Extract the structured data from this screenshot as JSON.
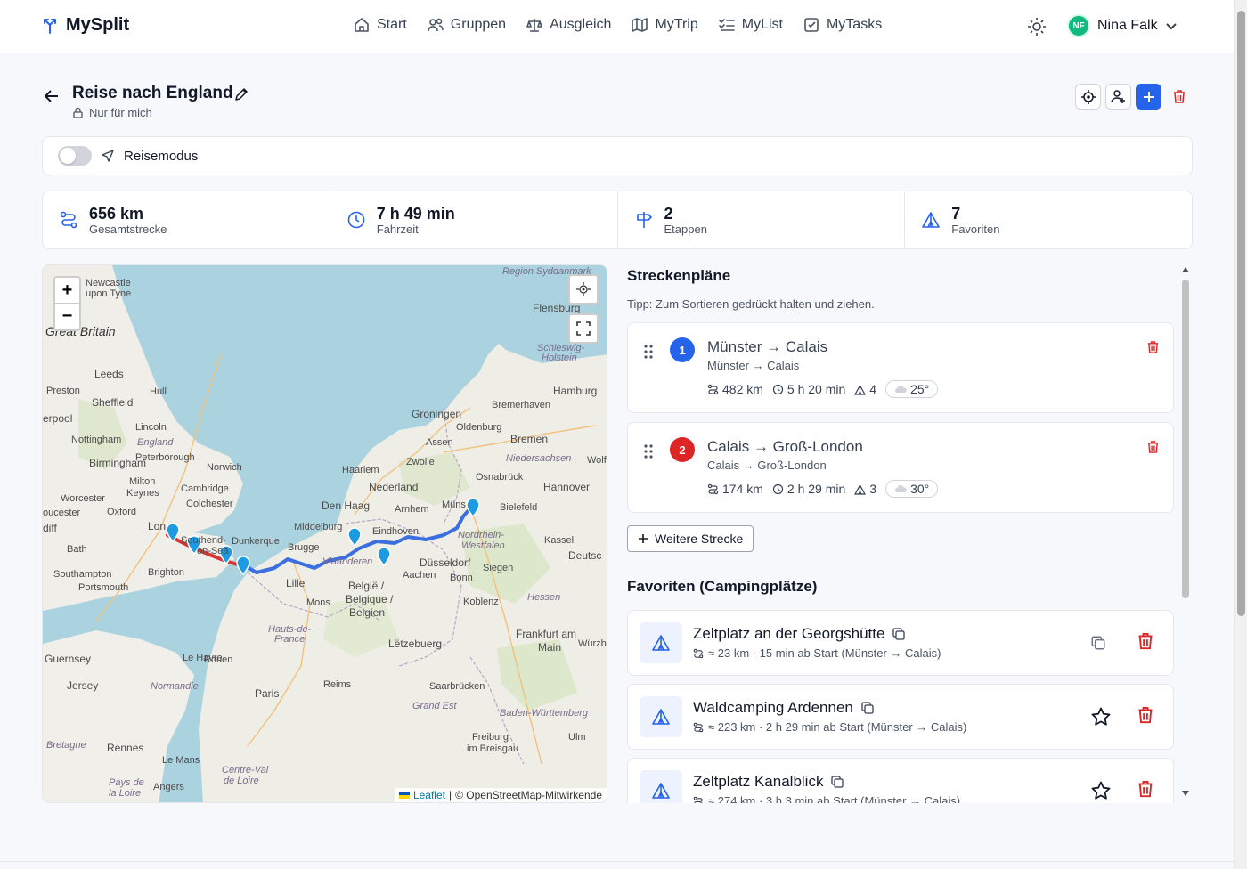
{
  "app": {
    "name": "MySplit"
  },
  "nav": [
    {
      "id": "start",
      "label": "Start",
      "icon": "home-icon"
    },
    {
      "id": "gruppen",
      "label": "Gruppen",
      "icon": "users-icon"
    },
    {
      "id": "ausgleich",
      "label": "Ausgleich",
      "icon": "scale-icon"
    },
    {
      "id": "mytrip",
      "label": "MyTrip",
      "icon": "map-icon"
    },
    {
      "id": "mylist",
      "label": "MyList",
      "icon": "list-check-icon"
    },
    {
      "id": "mytasks",
      "label": "MyTasks",
      "icon": "checkbox-icon"
    }
  ],
  "user": {
    "initials": "NF",
    "name": "Nina Falk"
  },
  "trip": {
    "title": "Reise nach England",
    "privacy": "Nur für mich",
    "travel_mode_label": "Reisemodus",
    "travel_mode_on": false
  },
  "stats": [
    {
      "value": "656 km",
      "label": "Gesamtstrecke",
      "icon": "route-icon"
    },
    {
      "value": "7 h 49 min",
      "label": "Fahrzeit",
      "icon": "clock-icon"
    },
    {
      "value": "2",
      "label": "Etappen",
      "icon": "signpost-icon"
    },
    {
      "value": "7",
      "label": "Favoriten",
      "icon": "tent-icon"
    }
  ],
  "map": {
    "zoom_in": "+",
    "zoom_out": "−",
    "attribution_link": "Leaflet",
    "attribution_sep": "|",
    "attribution_text": "© OpenStreetMap-Mitwirkende",
    "labels": {
      "region_syddanmark": "Region Syddanmark",
      "newcastle": "Newcastle",
      "upon_tyne": "upon Tyne",
      "flensburg": "Flensburg",
      "great_britain": "Great Britain",
      "schleswig": "Schleswig-",
      "holstein": "Holstein",
      "leeds": "Leeds",
      "preston": "Preston",
      "hull": "Hull",
      "hamburg": "Hamburg",
      "sheffield": "Sheffield",
      "groningen": "Groningen",
      "bremerhaven": "Bremerhaven",
      "liverpool": "erpool",
      "lincoln": "Lincoln",
      "oldenburg": "Oldenburg",
      "nottingham": "Nottingham",
      "england": "England",
      "assen": "Assen",
      "bremen": "Bremen",
      "birmingham": "Birmingham",
      "peterborough": "Peterborough",
      "norwich": "Norwich",
      "zwolle": "Zwolle",
      "niedersachsen": "Niedersachsen",
      "wolf": "Wolf",
      "haarlem": "Haarlem",
      "osnabrueck": "Osnabrück",
      "milton": "Milton",
      "keynes": "Keynes",
      "cambridge": "Cambridge",
      "nederland": "Nederland",
      "hannover": "Hannover",
      "worcester": "Worcester",
      "colchester": "Colchester",
      "den_haag": "Den Haag",
      "arnhem": "Arnhem",
      "muenster": "Müns",
      "bielefeld": "Bielefeld",
      "gloucester": "oucester",
      "oxford": "Oxford",
      "cardiff": "diff",
      "london": "Lon",
      "southend": "Southend-",
      "on_sea": "on-Sea",
      "middelburg": "Middelburg",
      "eindhoven": "Eindhoven",
      "nordrhein": "Nordrhein-",
      "westfalen": "Westfalen",
      "kassel": "Kassel",
      "bath": "Bath",
      "dunkerque": "Dunkerque",
      "brugge": "Brugge",
      "vlaanderen": "Vlaanderen",
      "duesseldorf": "Düsseldorf",
      "siegen": "Siegen",
      "deutschland": "Deutsc",
      "southampton": "Southampton",
      "brighton": "Brighton",
      "aachen": "Aachen",
      "bonn": "Bonn",
      "portsmouth": "Portsmouth",
      "lille": "Lille",
      "belgie": "België /",
      "belgique": "Belgique /",
      "belgien": "Belgien",
      "hessen": "Hessen",
      "mons": "Mons",
      "koblenz": "Koblenz",
      "hauts_de": "Hauts-de-",
      "france_region": "France",
      "letzebuerg": "Lëtzebuerg",
      "frankfurt": "Frankfurt am",
      "main": "Main",
      "guernsey": "Guernsey",
      "le_havre": "Le Havre",
      "rouen": "Rouen",
      "wuerzburg": "Würzbu",
      "jersey": "Jersey",
      "normandie": "Normandie",
      "paris": "Paris",
      "reims": "Reims",
      "saarbruecken": "Saarbrücken",
      "grand_est": "Grand Est",
      "bw_baden": "Baden-Württemberg",
      "bretagne": "Bretagne",
      "rennes": "Rennes",
      "freiburg": "Freiburg",
      "im_breisgau": "im Breisgau",
      "ulm": "Ulm",
      "le_mans": "Le Mans",
      "centre_val": "Centre-Val",
      "de_loire": "de Loire",
      "angers": "Angers",
      "pays_de": "Pays de",
      "la_loire": "la Loire"
    }
  },
  "routes_section": {
    "title": "Streckenpläne",
    "tip": "Tipp: Zum Sortieren gedrückt halten und ziehen.",
    "add_label": "Weitere Strecke",
    "items": [
      {
        "number": "1",
        "title": "Münster → Calais",
        "subtitle": "Münster → Calais",
        "distance": "482 km",
        "duration": "5 h 20 min",
        "camps": "4",
        "temp": "25°",
        "color": "#2563eb"
      },
      {
        "number": "2",
        "title": "Calais → Groß-London",
        "subtitle": "Calais → Groß-London",
        "distance": "174 km",
        "duration": "2 h 29 min",
        "camps": "3",
        "temp": "30°",
        "color": "#dc2626"
      }
    ]
  },
  "favorites_section": {
    "title": "Favoriten (Campingplätze)",
    "items": [
      {
        "title": "Zeltplatz an der Georgshütte",
        "info": "≈ 23 km · 15 min ab Start (Münster → Calais)"
      },
      {
        "title": "Waldcamping Ardennen",
        "info": "≈ 223 km · 2 h 29 min ab Start (Münster → Calais)"
      },
      {
        "title": "Zeltplatz Kanalblick",
        "info": "≈ 274 km · 3 h 3 min ab Start (Münster → Calais)"
      }
    ]
  },
  "colors": {
    "accent": "#2563eb",
    "danger": "#dc2626",
    "route_blue": "#3b6fe0",
    "route_red": "#d93535",
    "marker": "#1e9be0"
  }
}
